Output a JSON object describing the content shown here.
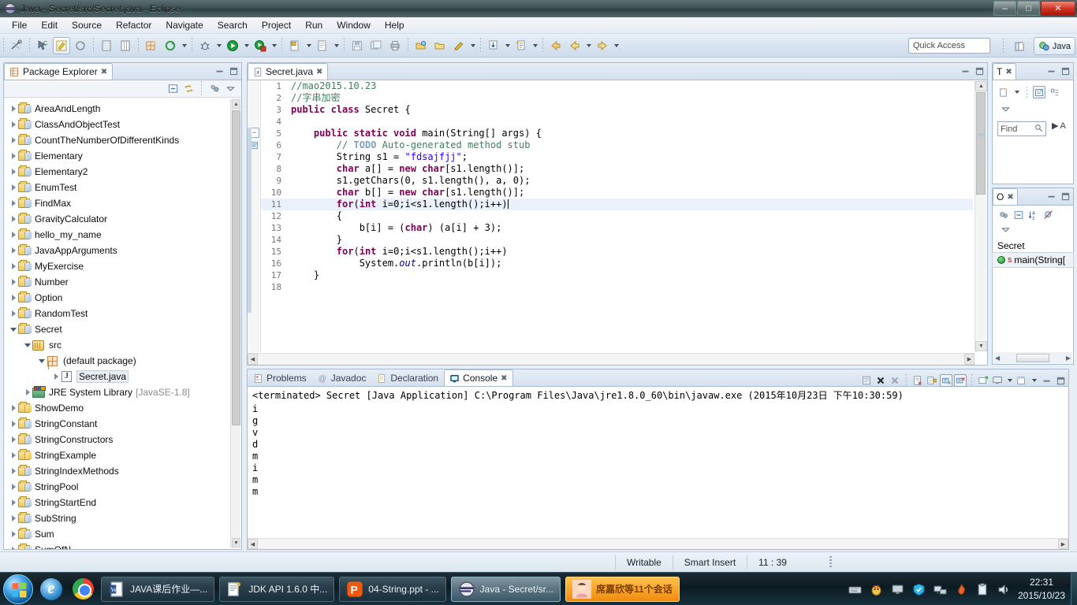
{
  "window": {
    "title": "Java - Secret/src/Secret.java - Eclipse",
    "app_icon": "eclipse-icon",
    "buttons": {
      "minimize": "–",
      "maximize": "□",
      "close": "✕"
    }
  },
  "menubar": {
    "items": [
      "File",
      "Edit",
      "Source",
      "Refactor",
      "Navigate",
      "Search",
      "Project",
      "Run",
      "Window",
      "Help"
    ]
  },
  "toolbar": {
    "quick_access_placeholder": "Quick Access",
    "perspective_label": "Java",
    "icons": [
      "toggle-breadcrumb-icon",
      "link-selection-icon",
      "edit-icon",
      "refresh-icon",
      "new-view-icon",
      "table-icon",
      "new-java-package-icon",
      "refresh-project-icon",
      "debug-icon",
      "run-icon",
      "coverage-icon",
      "new-java-class-icon",
      "new-java-project-icon",
      "save-icon",
      "save-all-icon",
      "print-icon",
      "open-type-icon",
      "open-resource-icon",
      "marker-icon",
      "external-tools-icon",
      "previous-annotation-icon",
      "back-icon",
      "forward-icon"
    ]
  },
  "package_explorer": {
    "title": "Package Explorer",
    "tools": [
      "collapse-all-icon",
      "link-with-editor-icon",
      "view-menu-icon",
      "minimize-icon",
      "maximize-icon"
    ],
    "tree": [
      {
        "label": "AreaAndLength",
        "icon": "project-folder-icon",
        "depth": 0,
        "expandable": true,
        "open": false
      },
      {
        "label": "ClassAndObjectTest",
        "icon": "project-folder-icon",
        "depth": 0,
        "expandable": true,
        "open": false
      },
      {
        "label": "CountTheNumberOfDifferentKinds",
        "icon": "project-folder-icon",
        "depth": 0,
        "expandable": true,
        "open": false
      },
      {
        "label": "Elementary",
        "icon": "project-folder-icon",
        "depth": 0,
        "expandable": true,
        "open": false
      },
      {
        "label": "Elementary2",
        "icon": "project-folder-icon",
        "depth": 0,
        "expandable": true,
        "open": false
      },
      {
        "label": "EnumTest",
        "icon": "project-folder-icon",
        "depth": 0,
        "expandable": true,
        "open": false
      },
      {
        "label": "FindMax",
        "icon": "project-folder-icon",
        "depth": 0,
        "expandable": true,
        "open": false
      },
      {
        "label": "GravityCalculator",
        "icon": "project-folder-icon",
        "depth": 0,
        "expandable": true,
        "open": false
      },
      {
        "label": "hello_my_name",
        "icon": "project-folder-icon",
        "depth": 0,
        "expandable": true,
        "open": false
      },
      {
        "label": "JavaAppArguments",
        "icon": "project-folder-icon",
        "depth": 0,
        "expandable": true,
        "open": false
      },
      {
        "label": "MyExercise",
        "icon": "project-folder-icon",
        "depth": 0,
        "expandable": true,
        "open": false
      },
      {
        "label": "Number",
        "icon": "project-folder-icon",
        "depth": 0,
        "expandable": true,
        "open": false
      },
      {
        "label": "Option",
        "icon": "project-folder-icon",
        "depth": 0,
        "expandable": true,
        "open": false
      },
      {
        "label": "RandomTest",
        "icon": "project-folder-icon",
        "depth": 0,
        "expandable": true,
        "open": false
      },
      {
        "label": "Secret",
        "icon": "project-folder-icon",
        "depth": 0,
        "expandable": true,
        "open": true
      },
      {
        "label": "src",
        "icon": "source-folder-icon",
        "depth": 1,
        "expandable": true,
        "open": true
      },
      {
        "label": "(default package)",
        "icon": "package-icon",
        "depth": 2,
        "expandable": true,
        "open": true
      },
      {
        "label": "Secret.java",
        "icon": "java-file-icon",
        "depth": 3,
        "expandable": true,
        "open": false,
        "selected": true
      },
      {
        "label": "JRE System Library",
        "sub": "[JavaSE-1.8]",
        "icon": "jre-library-icon",
        "depth": 1,
        "expandable": true,
        "open": false
      },
      {
        "label": "ShowDemo",
        "icon": "project-folder-warning-icon",
        "depth": 0,
        "expandable": true,
        "open": false
      },
      {
        "label": "StringConstant",
        "icon": "project-folder-icon",
        "depth": 0,
        "expandable": true,
        "open": false
      },
      {
        "label": "StringConstructors",
        "icon": "project-folder-icon",
        "depth": 0,
        "expandable": true,
        "open": false
      },
      {
        "label": "StringExample",
        "icon": "project-folder-warning-icon",
        "depth": 0,
        "expandable": true,
        "open": false
      },
      {
        "label": "StringIndexMethods",
        "icon": "project-folder-icon",
        "depth": 0,
        "expandable": true,
        "open": false
      },
      {
        "label": "StringPool",
        "icon": "project-folder-icon",
        "depth": 0,
        "expandable": true,
        "open": false
      },
      {
        "label": "StringStartEnd",
        "icon": "project-folder-icon",
        "depth": 0,
        "expandable": true,
        "open": false
      },
      {
        "label": "SubString",
        "icon": "project-folder-icon",
        "depth": 0,
        "expandable": true,
        "open": false
      },
      {
        "label": "Sum",
        "icon": "project-folder-icon",
        "depth": 0,
        "expandable": true,
        "open": false
      },
      {
        "label": "SumOfN",
        "icon": "project-folder-icon",
        "depth": 0,
        "expandable": true,
        "open": false
      }
    ]
  },
  "editor": {
    "tab_label": "Secret.java",
    "tab_icon": "java-file-icon",
    "tab_close": "✖",
    "lines": [
      {
        "n": "1",
        "segments": [
          {
            "t": "//mao2015.10.23",
            "c": "cmt"
          }
        ]
      },
      {
        "n": "2",
        "segments": [
          {
            "t": "//字串加密",
            "c": "cmt"
          }
        ]
      },
      {
        "n": "3",
        "segments": [
          {
            "t": "public class ",
            "c": "kw"
          },
          {
            "t": "Secret {",
            "c": "plain"
          }
        ]
      },
      {
        "n": "4",
        "segments": [
          {
            "t": "",
            "c": "plain"
          }
        ]
      },
      {
        "n": "5",
        "segments": [
          {
            "t": "    ",
            "c": "plain"
          },
          {
            "t": "public static void ",
            "c": "kw"
          },
          {
            "t": "main(String[] args) {",
            "c": "plain"
          }
        ],
        "fold": true
      },
      {
        "n": "6",
        "segments": [
          {
            "t": "        ",
            "c": "plain"
          },
          {
            "t": "// ",
            "c": "cmt"
          },
          {
            "t": "TODO",
            "c": "tdo"
          },
          {
            "t": " Auto-generated method stub",
            "c": "cmt"
          }
        ]
      },
      {
        "n": "7",
        "segments": [
          {
            "t": "        String s1 = ",
            "c": "plain"
          },
          {
            "t": "\"fdsajfjj\"",
            "c": "str"
          },
          {
            "t": ";",
            "c": "plain"
          }
        ]
      },
      {
        "n": "8",
        "segments": [
          {
            "t": "        ",
            "c": "plain"
          },
          {
            "t": "char ",
            "c": "kw"
          },
          {
            "t": "a[] = ",
            "c": "plain"
          },
          {
            "t": "new char",
            "c": "kw"
          },
          {
            "t": "[s1.length()];",
            "c": "plain"
          }
        ]
      },
      {
        "n": "9",
        "segments": [
          {
            "t": "        s1.getChars(0, s1.length(), a, 0);",
            "c": "plain"
          }
        ]
      },
      {
        "n": "10",
        "segments": [
          {
            "t": "        ",
            "c": "plain"
          },
          {
            "t": "char ",
            "c": "kw"
          },
          {
            "t": "b[] = ",
            "c": "plain"
          },
          {
            "t": "new char",
            "c": "kw"
          },
          {
            "t": "[s1.length()];",
            "c": "plain"
          }
        ]
      },
      {
        "n": "11",
        "segments": [
          {
            "t": "        ",
            "c": "plain"
          },
          {
            "t": "for",
            "c": "kw"
          },
          {
            "t": "(",
            "c": "plain"
          },
          {
            "t": "int ",
            "c": "kw"
          },
          {
            "t": "i=0;i<s1.length();i++)",
            "c": "plain"
          }
        ],
        "highlight": true,
        "caret": true
      },
      {
        "n": "12",
        "segments": [
          {
            "t": "        {",
            "c": "plain"
          }
        ]
      },
      {
        "n": "13",
        "segments": [
          {
            "t": "            b[i] = (",
            "c": "plain"
          },
          {
            "t": "char",
            "c": "kw"
          },
          {
            "t": ") (a[i] + 3);",
            "c": "plain"
          }
        ]
      },
      {
        "n": "14",
        "segments": [
          {
            "t": "        }",
            "c": "plain"
          }
        ]
      },
      {
        "n": "15",
        "segments": [
          {
            "t": "        ",
            "c": "plain"
          },
          {
            "t": "for",
            "c": "kw"
          },
          {
            "t": "(",
            "c": "plain"
          },
          {
            "t": "int ",
            "c": "kw"
          },
          {
            "t": "i=0;i<s1.length();i++)",
            "c": "plain"
          }
        ]
      },
      {
        "n": "16",
        "segments": [
          {
            "t": "            System.",
            "c": "plain"
          },
          {
            "t": "out",
            "c": "fld"
          },
          {
            "t": ".println(b[i]);",
            "c": "plain"
          }
        ]
      },
      {
        "n": "17",
        "segments": [
          {
            "t": "    }",
            "c": "plain"
          }
        ]
      },
      {
        "n": "18",
        "segments": [
          {
            "t": "",
            "c": "plain"
          }
        ]
      }
    ]
  },
  "console": {
    "tabs": [
      {
        "label": "Problems",
        "icon": "problems-icon",
        "active": false
      },
      {
        "label": "Javadoc",
        "icon": "javadoc-icon",
        "active": false
      },
      {
        "label": "Declaration",
        "icon": "declaration-icon",
        "active": false
      },
      {
        "label": "Console",
        "icon": "console-icon",
        "active": true
      }
    ],
    "tab_close": "✖",
    "tools": [
      "clear-console-icon",
      "terminate-icon",
      "remove-all-terminated-icon",
      "remove-launch-icon",
      "scroll-lock-icon",
      "word-wrap-icon",
      "pin-console-icon",
      "display-selected-console-icon",
      "open-console-icon",
      "minimize-icon",
      "maximize-icon"
    ],
    "header": "<terminated> Secret [Java Application] C:\\Program Files\\Java\\jre1.8.0_60\\bin\\javaw.exe (2015年10月23日 下午10:30:59)",
    "output": [
      "i",
      "g",
      "v",
      "d",
      "m",
      "i",
      "m",
      "m"
    ]
  },
  "task_list": {
    "title": "T",
    "tab_close": "✖",
    "find_placeholder": "Find",
    "find_icon": "search-icon",
    "tools": [
      "new-task-icon",
      "dropdown-icon",
      "categorize-icon",
      "filter-icon",
      "view-menu-icon"
    ],
    "section_arrow": "▶",
    "section_label": "A"
  },
  "outline": {
    "title": "O",
    "tab_close": "✖",
    "tools": [
      "focus-icon",
      "collapse-all-icon",
      "sort-icon",
      "hide-fields-icon",
      "view-menu-icon"
    ],
    "items": [
      {
        "label": "Secret",
        "icon": "class-icon",
        "selected": false,
        "badge": ""
      },
      {
        "label": "main(String[",
        "icon": "method-icon",
        "selected": true,
        "badge": "S"
      }
    ]
  },
  "statusbar": {
    "writable": "Writable",
    "insert_mode": "Smart Insert",
    "position": "11 : 39"
  },
  "taskbar": {
    "start_icon": "windows-start-icon",
    "quick_launch": [
      {
        "icon": "internet-explorer-icon",
        "name": "internet-explorer"
      },
      {
        "icon": "chrome-icon",
        "name": "google-chrome"
      }
    ],
    "tasks": [
      {
        "label": "JAVA课后作业—...",
        "icon": "word-document-icon",
        "active": false
      },
      {
        "label": "JDK API 1.6.0 中...",
        "icon": "chm-help-icon",
        "active": false
      },
      {
        "label": "04-String.ppt - ...",
        "icon": "wps-presentation-icon",
        "active": false
      },
      {
        "label": "Java - Secret/sr...",
        "icon": "eclipse-icon",
        "active": true
      },
      {
        "label": "席嘉欣等11个会话",
        "icon": "qq-avatar-icon",
        "active": false,
        "style": "qq"
      }
    ],
    "tray": [
      "keyboard-icon",
      "qq-icon",
      "monitor-icon",
      "security-shield-icon",
      "network-icon",
      "flame-icon",
      "clipboard-icon",
      "volume-icon"
    ],
    "clock_time": "22:31",
    "clock_date": "2015/10/23"
  },
  "colors": {
    "keyword": "#7f0055",
    "string": "#2a00ff",
    "comment": "#3f7f5f",
    "todo": "#7f9fbf",
    "field": "#0000c0",
    "accent": "#ffa000",
    "highlight_line": "#eaf1fb"
  }
}
